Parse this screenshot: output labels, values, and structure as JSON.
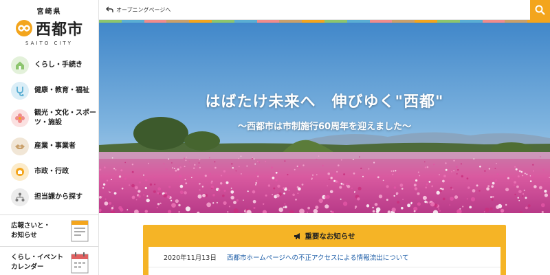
{
  "logo": {
    "prefecture": "宮崎県",
    "city": "西都市",
    "roman": "SAITO CITY"
  },
  "sidebar": {
    "items": [
      {
        "label": "くらし・手続き",
        "icon": "house-icon",
        "color": "#8cc56e"
      },
      {
        "label": "健康・教育・福祉",
        "icon": "stethoscope-icon",
        "color": "#5aaed3"
      },
      {
        "label": "観光・文化・スポーツ・施設",
        "icon": "flower-icon",
        "color": "#f08c8c"
      },
      {
        "label": "産業・事業者",
        "icon": "handshake-icon",
        "color": "#c9a06b"
      },
      {
        "label": "市政・行政",
        "icon": "city-hall-icon",
        "color": "#f3a51d"
      },
      {
        "label": "担当課から探す",
        "icon": "org-chart-icon",
        "color": "#b0b0b0"
      }
    ],
    "links": [
      {
        "label": "広報さいと・\nお知らせ",
        "icon": "newsletter-icon"
      },
      {
        "label": "くらし・イベント\nカレンダー",
        "icon": "calendar-icon"
      }
    ]
  },
  "topbar": {
    "back_label": "オープニングページへ",
    "search_icon": "search-icon",
    "accent": "#f3a51d"
  },
  "hero": {
    "title": "はばたけ未来へ　伸びゆく\"西都\"",
    "subtitle": "〜西都市は市制施行60周年を迎えました〜",
    "strip_colors": [
      "#8cc56e",
      "#5aaed3",
      "#f08c8c",
      "#c9a06b",
      "#f3a51d",
      "#8cc56e",
      "#5aaed3",
      "#f08c8c",
      "#c9a06b",
      "#f3a51d",
      "#8cc56e",
      "#5aaed3",
      "#f08c8c",
      "#c9a06b",
      "#f3a51d",
      "#8cc56e",
      "#5aaed3",
      "#f08c8c",
      "#c9a06b",
      "#f3a51d"
    ]
  },
  "notice": {
    "heading": "重要なお知らせ",
    "items": [
      {
        "date": "2020年11月13日",
        "text": "西都市ホームページへの不正アクセスによる情報流出について"
      }
    ]
  }
}
